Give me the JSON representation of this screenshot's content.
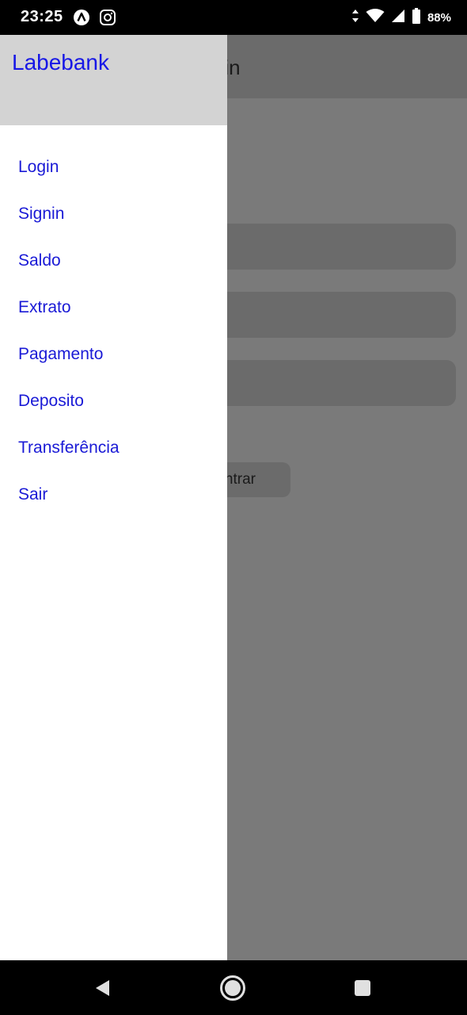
{
  "status_bar": {
    "time": "23:25",
    "battery": "88%",
    "icons": [
      "app-a-icon",
      "instagram-icon",
      "data-arrows-icon",
      "wifi-icon",
      "signal-icon",
      "battery-icon"
    ]
  },
  "background_screen": {
    "title": "Login",
    "button_label": "Entrar"
  },
  "drawer": {
    "title": "Labebank",
    "items": [
      {
        "label": "Login"
      },
      {
        "label": "Signin"
      },
      {
        "label": "Saldo"
      },
      {
        "label": "Extrato"
      },
      {
        "label": "Pagamento"
      },
      {
        "label": "Deposito"
      },
      {
        "label": "Transferência"
      },
      {
        "label": "Sair"
      }
    ]
  },
  "nav_bar": {
    "icons": [
      "back-icon",
      "home-icon",
      "recents-icon"
    ]
  },
  "colors": {
    "drawer_header_bg": "#d3d3d3",
    "link_blue": "#1a1ad6",
    "scrim": "#7a7a7a"
  }
}
